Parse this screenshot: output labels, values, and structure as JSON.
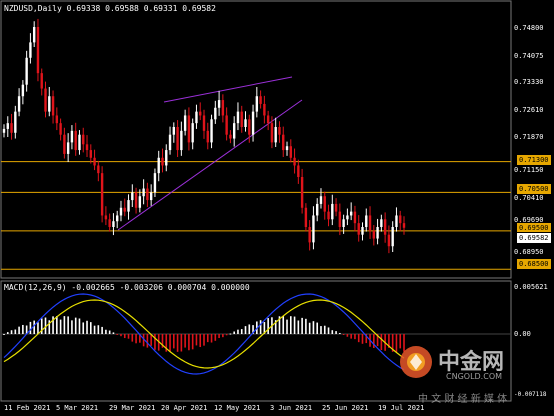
{
  "header": {
    "title": "NZDUSD,Daily",
    "ohlc": "0.69338 0.69588 0.69331 0.69582"
  },
  "macd": {
    "label": "MACD(12,26,9) -0.002665 -0.003206 0.000704 0.000000",
    "axis_top": "0.005621",
    "axis_zero": "0.00",
    "axis_bottom": "-0.007118"
  },
  "price_axis": [
    "0.74800",
    "0.74075",
    "0.73330",
    "0.72610",
    "0.71870",
    "0.71150",
    "0.70410",
    "0.69690",
    "0.68950"
  ],
  "levels": [
    {
      "label": "0.71300",
      "value": 0.713
    },
    {
      "label": "0.70500",
      "value": 0.705
    },
    {
      "label": "0.69500",
      "value": 0.695
    },
    {
      "label": "0.68500",
      "value": 0.685
    }
  ],
  "current_price_label": "0.69582",
  "dates": [
    "11 Feb 2021",
    "5 Mar 2021",
    "29 Mar 2021",
    "20 Apr 2021",
    "12 May 2021",
    "3 Jun 2021",
    "25 Jun 2021",
    "19 Jul 2021"
  ],
  "watermark": {
    "brand": "中金网",
    "domain": "CNGOLD.COM",
    "slogan": "中 文 财 经 新 媒 体"
  },
  "colors": {
    "background": "#000000",
    "bull": "#ffffff",
    "bear": "#e0141b",
    "level": "#e6a700",
    "trendline": "#9b30d9",
    "macd_main": "#2140ff",
    "macd_signal": "#e8e000"
  }
}
